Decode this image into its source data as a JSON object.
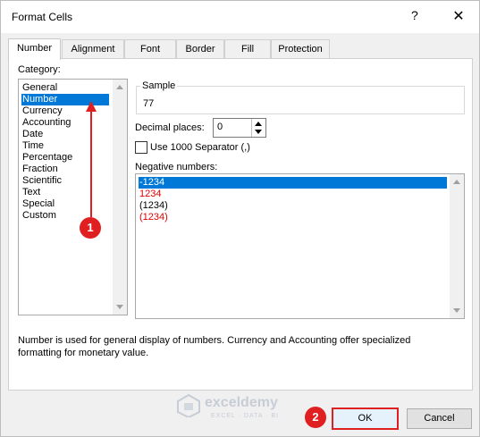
{
  "window": {
    "title": "Format Cells",
    "help": "?",
    "close": "✕"
  },
  "tabs": [
    "Number",
    "Alignment",
    "Font",
    "Border",
    "Fill",
    "Protection"
  ],
  "category": {
    "label": "Category:",
    "items": [
      "General",
      "Number",
      "Currency",
      "Accounting",
      "Date",
      "Time",
      "Percentage",
      "Fraction",
      "Scientific",
      "Text",
      "Special",
      "Custom"
    ],
    "selected": "Number"
  },
  "sample": {
    "label": "Sample",
    "value": "77"
  },
  "decimal_places": {
    "label": "Decimal places:",
    "value": "0"
  },
  "separator": {
    "label": "Use 1000 Separator (,)",
    "checked": false
  },
  "negative_numbers": {
    "label": "Negative numbers:",
    "items": [
      {
        "text": "-1234",
        "color": "#000000",
        "selected": true
      },
      {
        "text": "1234",
        "color": "#e00000",
        "selected": false
      },
      {
        "text": "(1234)",
        "color": "#000000",
        "selected": false
      },
      {
        "text": "(1234)",
        "color": "#e00000",
        "selected": false
      }
    ]
  },
  "description": "Number is used for general display of numbers.  Currency and Accounting offer specialized formatting for monetary value.",
  "buttons": {
    "ok": "OK",
    "cancel": "Cancel"
  },
  "annotations": {
    "badge1": "1",
    "badge2": "2"
  },
  "watermark": {
    "name": "exceldemy",
    "tagline": "EXCEL · DATA · BI"
  },
  "colors": {
    "selection": "#0078d7",
    "annotation": "#e02020",
    "negative_red": "#e00000"
  }
}
